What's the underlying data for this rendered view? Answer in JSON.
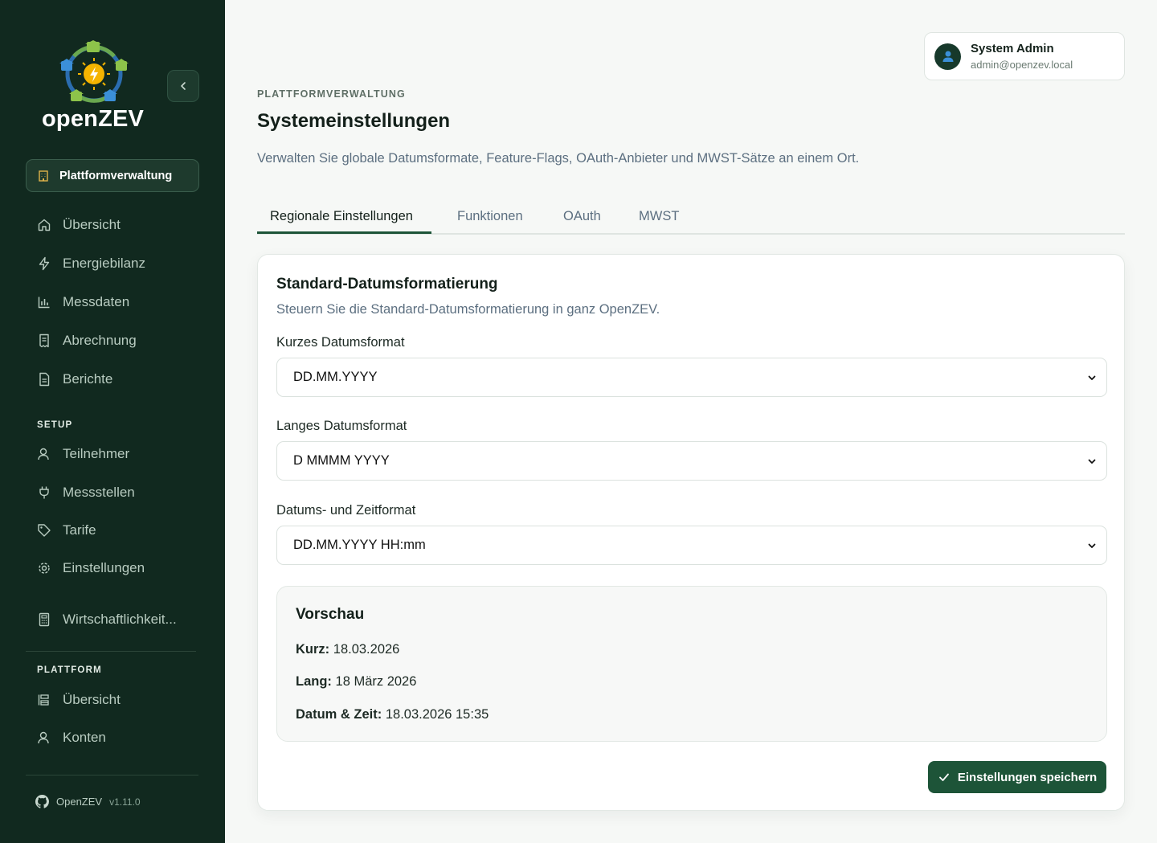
{
  "app": {
    "name": "openZEV"
  },
  "sidebar": {
    "collapse_label": "‹",
    "platform_pill": "Plattformverwaltung",
    "items": [
      {
        "label": "Übersicht",
        "icon": "home-icon"
      },
      {
        "label": "Energiebilanz",
        "icon": "lightning-icon"
      },
      {
        "label": "Messdaten",
        "icon": "bar-chart-icon"
      },
      {
        "label": "Abrechnung",
        "icon": "receipt-icon"
      },
      {
        "label": "Berichte",
        "icon": "document-icon"
      }
    ],
    "setup_heading": "SETUP",
    "setup_items": [
      {
        "label": "Teilnehmer",
        "icon": "user-icon"
      },
      {
        "label": "Messstellen",
        "icon": "plug-icon"
      },
      {
        "label": "Tarife",
        "icon": "tag-icon"
      },
      {
        "label": "Einstellungen",
        "icon": "gear-icon"
      }
    ],
    "extra_item": {
      "label": "Wirtschaftlichkeit...",
      "icon": "calculator-icon"
    },
    "platform_heading": "PLATTFORM",
    "platform_items": [
      {
        "label": "Übersicht",
        "icon": "dashboard-icon"
      },
      {
        "label": "Konten",
        "icon": "user-icon"
      }
    ],
    "footer": {
      "name": "OpenZEV",
      "version": "v1.11.0"
    }
  },
  "user": {
    "name": "System Admin",
    "email": "admin@openzev.local"
  },
  "header": {
    "eyebrow": "PLATTFORMVERWALTUNG",
    "title": "Systemeinstellungen",
    "description": "Verwalten Sie globale Datumsformate, Feature-Flags, OAuth-Anbieter und MWST-Sätze an einem Ort."
  },
  "tabs": [
    {
      "label": "Regionale Einstellungen",
      "active": true
    },
    {
      "label": "Funktionen",
      "active": false
    },
    {
      "label": "OAuth",
      "active": false
    },
    {
      "label": "MWST",
      "active": false
    }
  ],
  "card": {
    "title": "Standard-Datumsformatierung",
    "description": "Steuern Sie die Standard-Datumsformatierung in ganz OpenZEV.",
    "fields": [
      {
        "label": "Kurzes Datumsformat",
        "value": "DD.MM.YYYY"
      },
      {
        "label": "Langes Datumsformat",
        "value": "D MMMM YYYY"
      },
      {
        "label": "Datums- und Zeitformat",
        "value": "DD.MM.YYYY HH:mm"
      }
    ],
    "preview": {
      "title": "Vorschau",
      "rows": [
        {
          "label": "Kurz:",
          "value": "18.03.2026"
        },
        {
          "label": "Lang:",
          "value": "18 März 2026"
        },
        {
          "label": "Datum & Zeit:",
          "value": "18.03.2026 15:35"
        }
      ]
    },
    "save_label": "Einstellungen speichern"
  },
  "colors": {
    "sidebar_bg": "#11291f",
    "accent": "#1d5438",
    "page_bg": "#f6f8f6"
  }
}
